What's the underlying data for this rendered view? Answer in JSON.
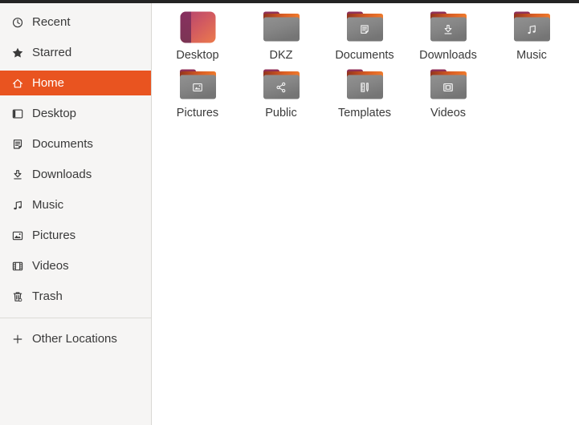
{
  "colors": {
    "accent_orange": "#E95420",
    "topbar": "#242424",
    "sidebar_bg": "#f6f5f4",
    "main_bg": "#ffffff",
    "text": "#3a3a3a",
    "folder_gray": "#858585",
    "folder_flap_maroon": "#8e2f50",
    "folder_back_orange": "#e96b2d"
  },
  "sidebar": {
    "items": [
      {
        "label": "Recent",
        "icon": "clock-icon",
        "selected": false
      },
      {
        "label": "Starred",
        "icon": "star-icon",
        "selected": false
      },
      {
        "label": "Home",
        "icon": "home-icon",
        "selected": true
      },
      {
        "label": "Desktop",
        "icon": "desktop-icon",
        "selected": false
      },
      {
        "label": "Documents",
        "icon": "document-icon",
        "selected": false
      },
      {
        "label": "Downloads",
        "icon": "download-icon",
        "selected": false
      },
      {
        "label": "Music",
        "icon": "music-note-icon",
        "selected": false
      },
      {
        "label": "Pictures",
        "icon": "image-icon",
        "selected": false
      },
      {
        "label": "Videos",
        "icon": "film-icon",
        "selected": false
      },
      {
        "label": "Trash",
        "icon": "trash-icon",
        "selected": false
      }
    ],
    "footer_items": [
      {
        "label": "Other Locations",
        "icon": "plus-icon",
        "selected": false
      }
    ]
  },
  "files": {
    "items": [
      {
        "label": "Desktop",
        "icon": "desktop-gradient-icon",
        "emblem": null
      },
      {
        "label": "DKZ",
        "icon": "folder-icon",
        "emblem": null
      },
      {
        "label": "Documents",
        "icon": "folder-icon",
        "emblem": "document-emblem"
      },
      {
        "label": "Downloads",
        "icon": "folder-icon",
        "emblem": "download-emblem"
      },
      {
        "label": "Music",
        "icon": "folder-icon",
        "emblem": "music-emblem"
      },
      {
        "label": "Pictures",
        "icon": "folder-icon",
        "emblem": "image-emblem"
      },
      {
        "label": "Public",
        "icon": "folder-icon",
        "emblem": "share-emblem"
      },
      {
        "label": "Templates",
        "icon": "folder-icon",
        "emblem": "templates-emblem"
      },
      {
        "label": "Videos",
        "icon": "folder-icon",
        "emblem": "video-emblem"
      }
    ]
  }
}
